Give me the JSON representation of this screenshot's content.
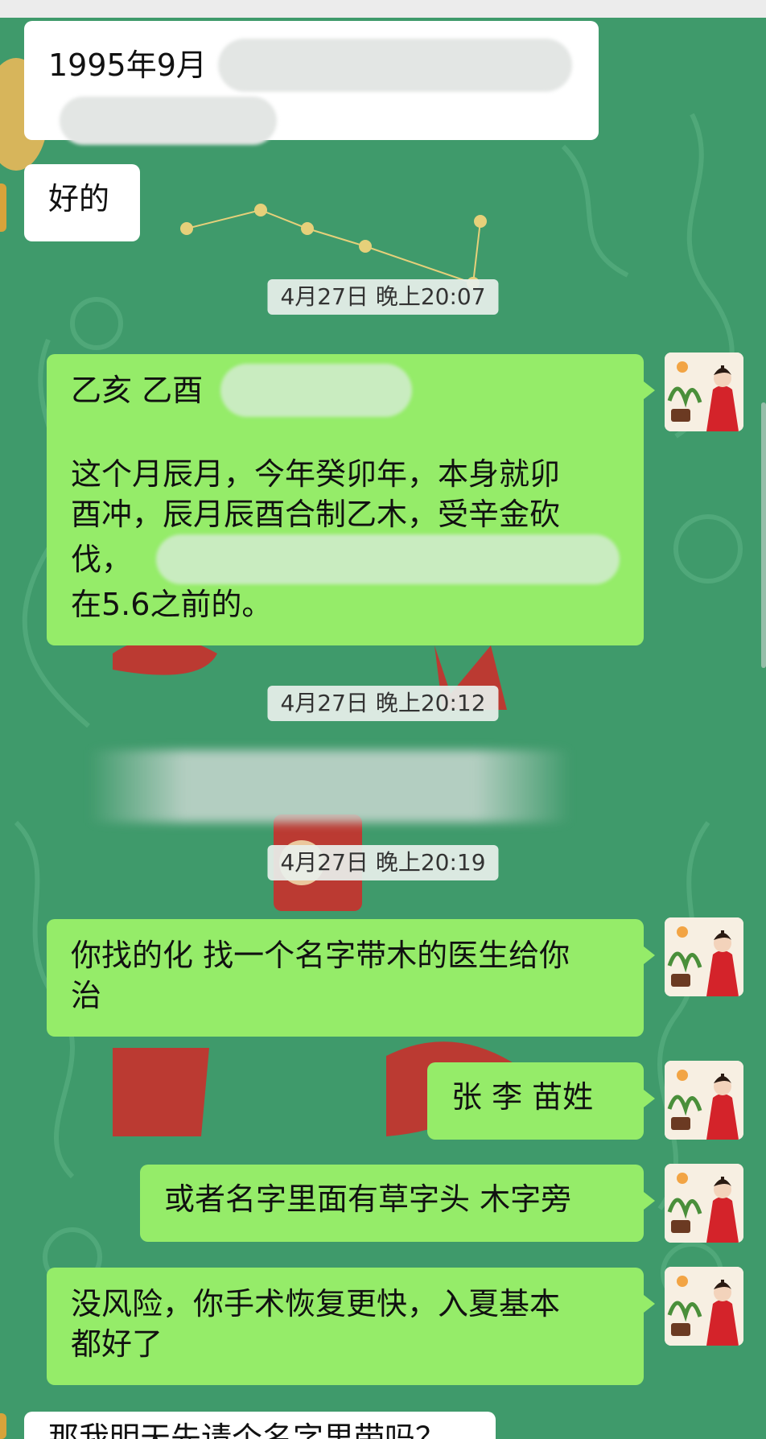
{
  "messages": {
    "m1_text": "1995年9月",
    "m2_text": "好的",
    "t1": "4月27日  晚上20:07",
    "m3_line1": "乙亥  乙酉",
    "m3_line2": "这个月辰月，今年癸卯年，本身就卯",
    "m3_line3": "酉冲，辰月辰酉合制乙木，受辛金砍",
    "m3_line4": "伐，",
    "m3_line5": "在5.6之前的。",
    "t2": "4月27日  晚上20:12",
    "t3": "4月27日  晚上20:19",
    "m4_line1": "你找的化  找一个名字带木的医生给你",
    "m4_line2": "治",
    "m5_text": "张  李  苗姓",
    "m6_text": "或者名字里面有草字头  木字旁",
    "m7_line1": "没风险，你手术恢复更快，入夏基本",
    "m7_line2": "都好了",
    "m8_text": "那我明天先请个名字里带吗？"
  },
  "colors": {
    "background": "#3f9a6b",
    "sent_bubble": "#95ec69",
    "received_bubble": "#ffffff",
    "timestamp_bg": "#e8f0ec"
  },
  "icons": {
    "avatar": "woman-in-red-hanfu-avatar"
  }
}
